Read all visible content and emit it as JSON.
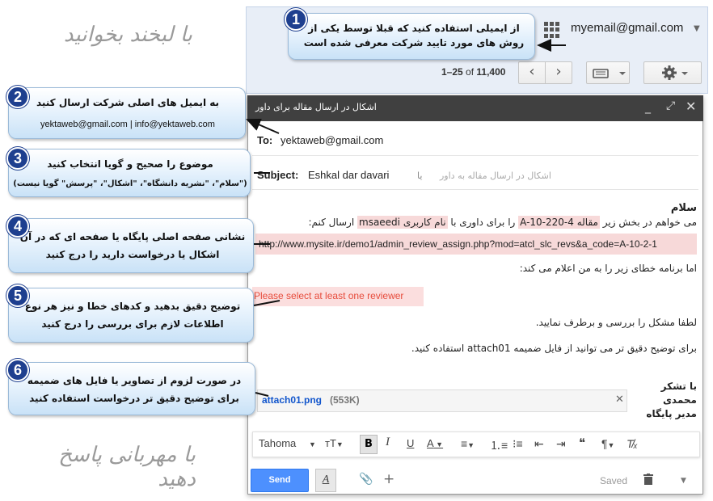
{
  "account": {
    "email": "myemail@gmail.com"
  },
  "pager": {
    "range": "1–25",
    "of": "of",
    "total": "11,400"
  },
  "compose": {
    "title": "اشکال در ارسال مقاله برای داور",
    "to_label": "To:",
    "to_value": "yektaweb@gmail.com",
    "subject_label": "Subject:",
    "subject_value": "Eshkal dar davari",
    "subject_hint_alt": "یا",
    "subject_hint_fa": "اشکال در ارسال مقاله به داور",
    "body": {
      "greeting": "سلام",
      "line1_a": "می خواهم در بخش زیر ",
      "line1_hl1": "مقاله A-10-220-4",
      "line1_b": " را برای داوری با ",
      "line1_hl2": "نام کاربری msaeedi",
      "line1_c": " ارسال کنم:",
      "url": "http://www.mysite.ir/demo1/admin_review_assign.php?mod=atcl_slc_revs&a_code=A-10-2-1",
      "error_intro": "اما برنامه خطای زیر را به من اعلام می کند:",
      "error_message": "Please select at least one reviewer",
      "please_fix": "لطفا مشکل را بررسی و برطرف نمایید.",
      "attach_note": "برای توضیح دقیق تر می توانید از فایل ضمیمه attach01 استفاده کنید.",
      "sig_thanks": "با تشکر",
      "sig_name": "محمدی",
      "sig_title": "مدیر پایگاه"
    },
    "attachment": {
      "name": "attach01.png",
      "size": "(553K)"
    },
    "toolbar": {
      "font": "Tahoma",
      "bold": "B"
    },
    "send_label": "Send",
    "saved_label": "Saved"
  },
  "callouts": [
    {
      "num": "1",
      "text": "از ایمیلی استفاده کنید که قبلا توسط یکی از روش های مورد تایید شرکت معرفی شده است"
    },
    {
      "num": "2",
      "text": "به ایمیل های اصلی شرکت ارسال کنید",
      "sub": "yektaweb@gmail.com  |  info@yektaweb.com"
    },
    {
      "num": "3",
      "text": "موضوع را صحیح و گویا انتخاب کنید",
      "sub": "(\"سلام\"، \"نشریه دانشگاه\"، \"اشکال\"، \"پرسش\" گویا نیست)"
    },
    {
      "num": "4",
      "text": "نشانی صفحه اصلی پایگاه یا صفحه ای که در آن اشکال یا درخواست دارید را درج کنید"
    },
    {
      "num": "5",
      "text": "توضیح دقیق بدهید و کدهای خطا و نیز هر نوع اطلاعات لازم برای بررسی را درج کنید"
    },
    {
      "num": "6",
      "text": "در صورت لزوم از تصاویر یا فایل های ضمیمه برای توضیح دقیق تر درخواست استفاده کنید"
    }
  ],
  "calligraphy": {
    "top": "با لبخند بخوانید",
    "bottom": "با مهربانی پاسخ دهید"
  },
  "colors": {
    "accent": "#4d90fe",
    "highlight": "#f7d9d9",
    "error": "#e74c3c",
    "badge": "#1e3f8f"
  }
}
